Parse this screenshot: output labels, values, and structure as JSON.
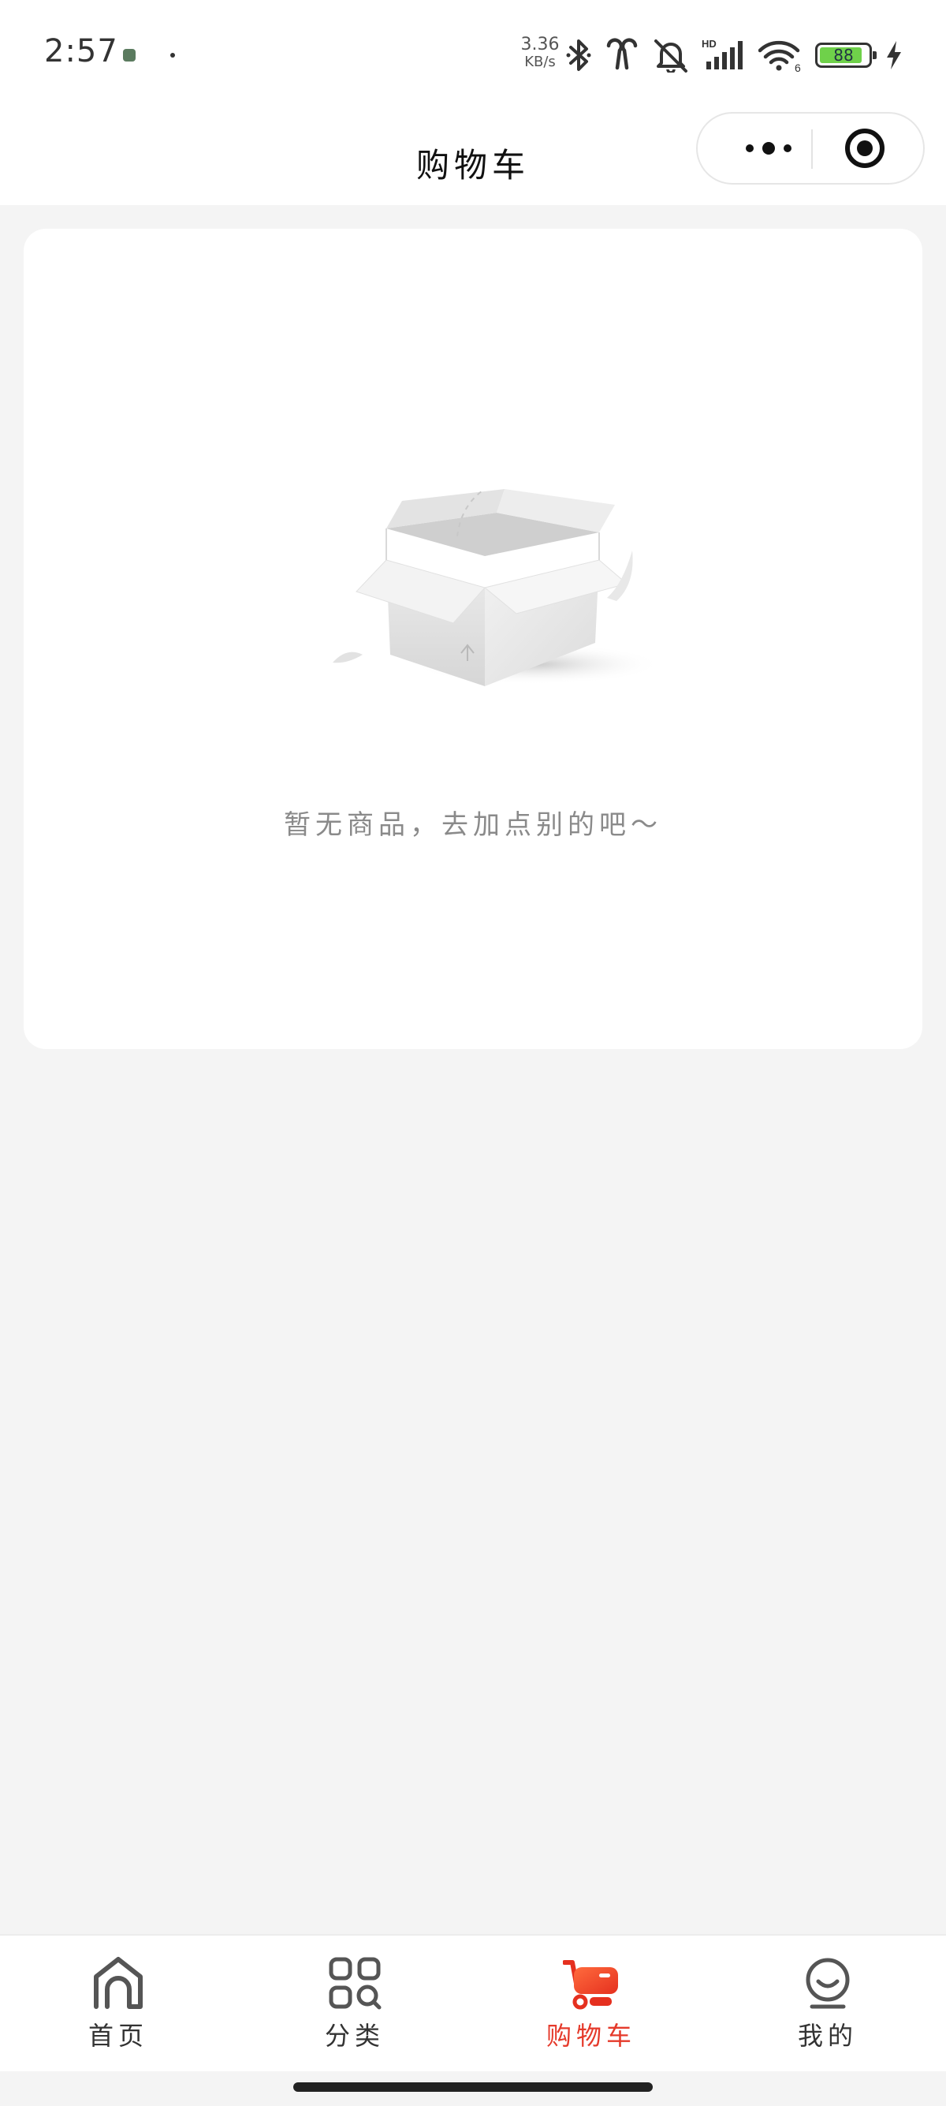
{
  "status_bar": {
    "time": "2:57",
    "network_speed_value": "3.36",
    "network_speed_unit": "KB/s",
    "battery_level": "88",
    "battery_fraction": 0.88,
    "wifi_label": "6",
    "signal_label": "HD",
    "icons": [
      "app-notification-icon",
      "bluetooth-icon",
      "earbuds-icon",
      "mute-icon",
      "signal-icon",
      "wifi-icon",
      "battery-icon",
      "charging-icon"
    ]
  },
  "nav_bar": {
    "title": "购物车"
  },
  "empty_state": {
    "illustration": "empty-box",
    "message": "暂无商品，去加点别的吧～"
  },
  "tab_bar": {
    "active_color": "#e53a2b",
    "tabs": [
      {
        "label": "首页",
        "icon": "home-icon",
        "active": false
      },
      {
        "label": "分类",
        "icon": "category-icon",
        "active": false
      },
      {
        "label": "购物车",
        "icon": "cart-icon",
        "active": true
      },
      {
        "label": "我的",
        "icon": "profile-icon",
        "active": false
      }
    ]
  }
}
